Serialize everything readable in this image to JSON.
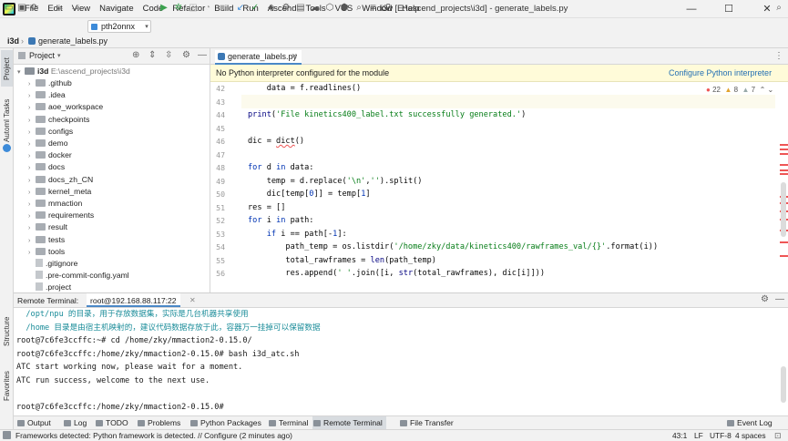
{
  "window": {
    "title": "i3d [E:\\ascend_projects\\i3d] - generate_labels.py",
    "menu": [
      "File",
      "Edit",
      "View",
      "Navigate",
      "Code",
      "Refactor",
      "Build",
      "Run",
      "Ascend",
      "Tools",
      "VCS",
      "Window",
      "Help"
    ],
    "minimize": "—",
    "maximize": "☐",
    "close": "✕"
  },
  "toolbar": {
    "run_config": "pth2onnx"
  },
  "breadcrumb": {
    "project": "i3d",
    "file": "generate_labels.py"
  },
  "left_strip": {
    "project_tab": "Project",
    "ascend_tasks_tab": "Automl Tasks",
    "structure_tab": "Structure",
    "favorites_tab": "Favorites"
  },
  "project_panel": {
    "title": "Project",
    "root_name": "i3d",
    "root_path": "E:\\ascend_projects\\i3d",
    "items": [
      {
        "name": ".github",
        "type": "folder"
      },
      {
        "name": ".idea",
        "type": "folder"
      },
      {
        "name": "aoe_workspace",
        "type": "folder"
      },
      {
        "name": "checkpoints",
        "type": "folder"
      },
      {
        "name": "configs",
        "type": "folder"
      },
      {
        "name": "demo",
        "type": "folder"
      },
      {
        "name": "docker",
        "type": "folder"
      },
      {
        "name": "docs",
        "type": "folder"
      },
      {
        "name": "docs_zh_CN",
        "type": "folder"
      },
      {
        "name": "kernel_meta",
        "type": "folder"
      },
      {
        "name": "mmaction",
        "type": "folder"
      },
      {
        "name": "requirements",
        "type": "folder"
      },
      {
        "name": "result",
        "type": "folder"
      },
      {
        "name": "tests",
        "type": "folder"
      },
      {
        "name": "tools",
        "type": "folder"
      },
      {
        "name": ".gitignore",
        "type": "file"
      },
      {
        "name": ".pre-commit-config.yaml",
        "type": "file"
      },
      {
        "name": ".project",
        "type": "file"
      }
    ]
  },
  "editor": {
    "tab": "generate_labels.py",
    "warning": "No Python interpreter configured for the module",
    "warning_action": "Configure Python interpreter",
    "inspections": {
      "errors": "22",
      "warnings": "8",
      "weak": "7"
    },
    "line_numbers": [
      "42",
      "43",
      "44",
      "45",
      "46",
      "47",
      "48",
      "49",
      "50",
      "51",
      "52",
      "53",
      "54",
      "55",
      "56"
    ]
  },
  "terminal": {
    "label": "Remote Terminal:",
    "tab": "root@192.168.88.117:22",
    "lines": [
      "  /opt/npu 的目录，用于存放数据集，实际是几台机器共享使用",
      "  /home 目录是由宿主机映射的，建议代码数据存放于此，容器万一挂掉可以保留数据",
      "root@7c6fe3ccffc:~# cd /home/zky/mmaction2-0.15.0/",
      "root@7c6fe3ccffc:/home/zky/mmaction2-0.15.0# bash i3d_atc.sh",
      "ATC start working now, please wait for a moment.",
      "ATC run success, welcome to the next use.",
      "",
      "root@7c6fe3ccffc:/home/zky/mmaction2-0.15.0#"
    ]
  },
  "bottom_tools": [
    "Output",
    "Log",
    "TODO",
    "Problems",
    "Python Packages",
    "Terminal",
    "Remote Terminal",
    "File Transfer"
  ],
  "event_log": "Event Log",
  "status": {
    "message": "Frameworks detected: Python framework is detected. // Configure (2 minutes ago)",
    "position": "43:1",
    "line_sep": "LF",
    "encoding": "UTF-8",
    "indent": "4 spaces"
  },
  "colors": {
    "accent": "#4a88c7",
    "warning_bg": "#fffbd9",
    "keyword": "#0033b3",
    "string": "#067d17",
    "terminal_info": "#1a8c99"
  }
}
